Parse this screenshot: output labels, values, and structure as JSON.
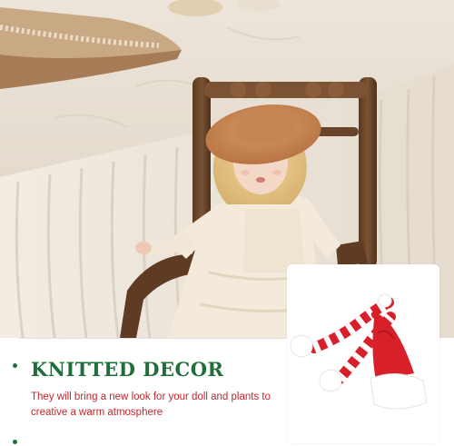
{
  "banner": {
    "headline": "KNITTED DECOR",
    "description": "They will bring a new look for your doll and plants to creative a warm atmosphere"
  },
  "colors": {
    "headline": "#1f6e3c",
    "description": "#c0262c",
    "hat_red": "#d8202a",
    "trim_white": "#ffffff"
  },
  "icons": [
    "doll-figure",
    "wooden-chair",
    "santa-hat",
    "knitted-scarf"
  ]
}
